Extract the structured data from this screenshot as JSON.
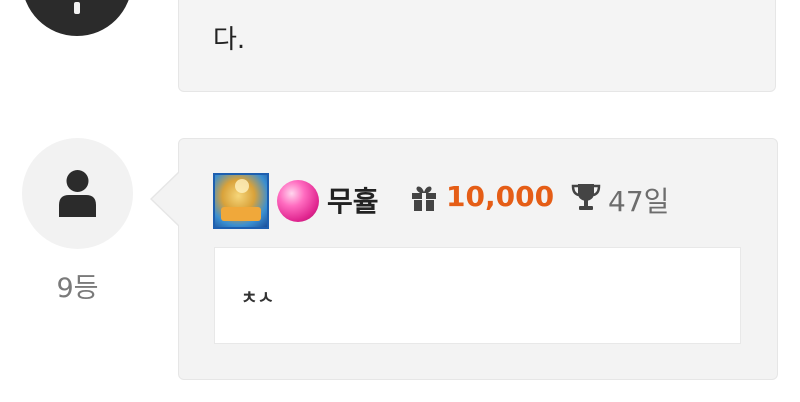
{
  "previous_comment": {
    "text_fragment": "다."
  },
  "comment": {
    "rank": "9등",
    "username": "무휼",
    "points": "10,000",
    "membership_days": "47일",
    "content": "ㅊㅅ",
    "icons": {
      "avatar": "person-silhouette-icon",
      "level_badge": "level-badge-icon",
      "gem": "pink-gem-icon",
      "points": "gift-icon",
      "days": "trophy-icon"
    },
    "colors": {
      "points": "#e55d16",
      "bubble": "#f3f3f3",
      "avatar_bg": "#f2f2f2"
    }
  }
}
